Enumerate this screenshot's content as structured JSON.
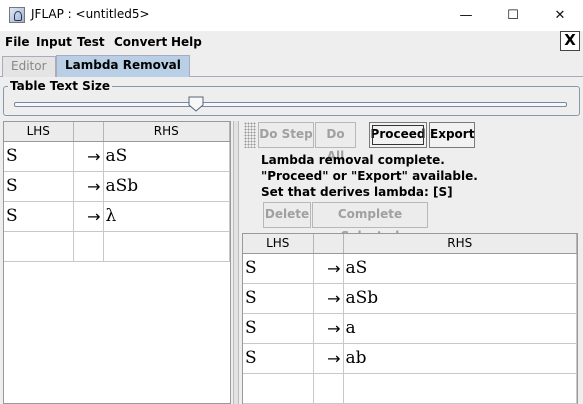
{
  "window": {
    "title": "JFLAP : <untitled5>",
    "minimize": "—",
    "maximize": "☐",
    "close": "✕"
  },
  "menu": [
    "File",
    "Input",
    "Test",
    "Convert",
    "Help"
  ],
  "frame_close": "X",
  "tabs": [
    {
      "label": "Editor",
      "active": false
    },
    {
      "label": "Lambda Removal",
      "active": true
    }
  ],
  "table_text_size": {
    "label": "Table Text Size",
    "slider_fraction": 0.33
  },
  "left_grammar": {
    "headers": [
      "LHS",
      "",
      "RHS"
    ],
    "rows": [
      {
        "lhs": "S",
        "arrow": "→",
        "rhs": "aS"
      },
      {
        "lhs": "S",
        "arrow": "→",
        "rhs": "aSb"
      },
      {
        "lhs": "S",
        "arrow": "→",
        "rhs": "λ"
      },
      {
        "lhs": "",
        "arrow": "",
        "rhs": ""
      }
    ]
  },
  "toolbar": {
    "do_step": "Do Step",
    "do_all": "Do All",
    "proceed": "Proceed",
    "export": "Export"
  },
  "status": {
    "line1": "Lambda removal complete.",
    "line2": "\"Proceed\" or \"Export\" available.",
    "line3": "Set that derives lambda: [S]"
  },
  "actions": {
    "delete": "Delete",
    "complete_selected": "Complete Selected"
  },
  "right_grammar": {
    "headers": [
      "LHS",
      "",
      "RHS"
    ],
    "rows": [
      {
        "lhs": "S",
        "arrow": "→",
        "rhs": "aS"
      },
      {
        "lhs": "S",
        "arrow": "→",
        "rhs": "aSb"
      },
      {
        "lhs": "S",
        "arrow": "→",
        "rhs": "a"
      },
      {
        "lhs": "S",
        "arrow": "→",
        "rhs": "ab"
      },
      {
        "lhs": "",
        "arrow": "",
        "rhs": ""
      }
    ]
  },
  "colors": {
    "active_tab": "#b8cfe5",
    "background": "#eeeeee"
  }
}
